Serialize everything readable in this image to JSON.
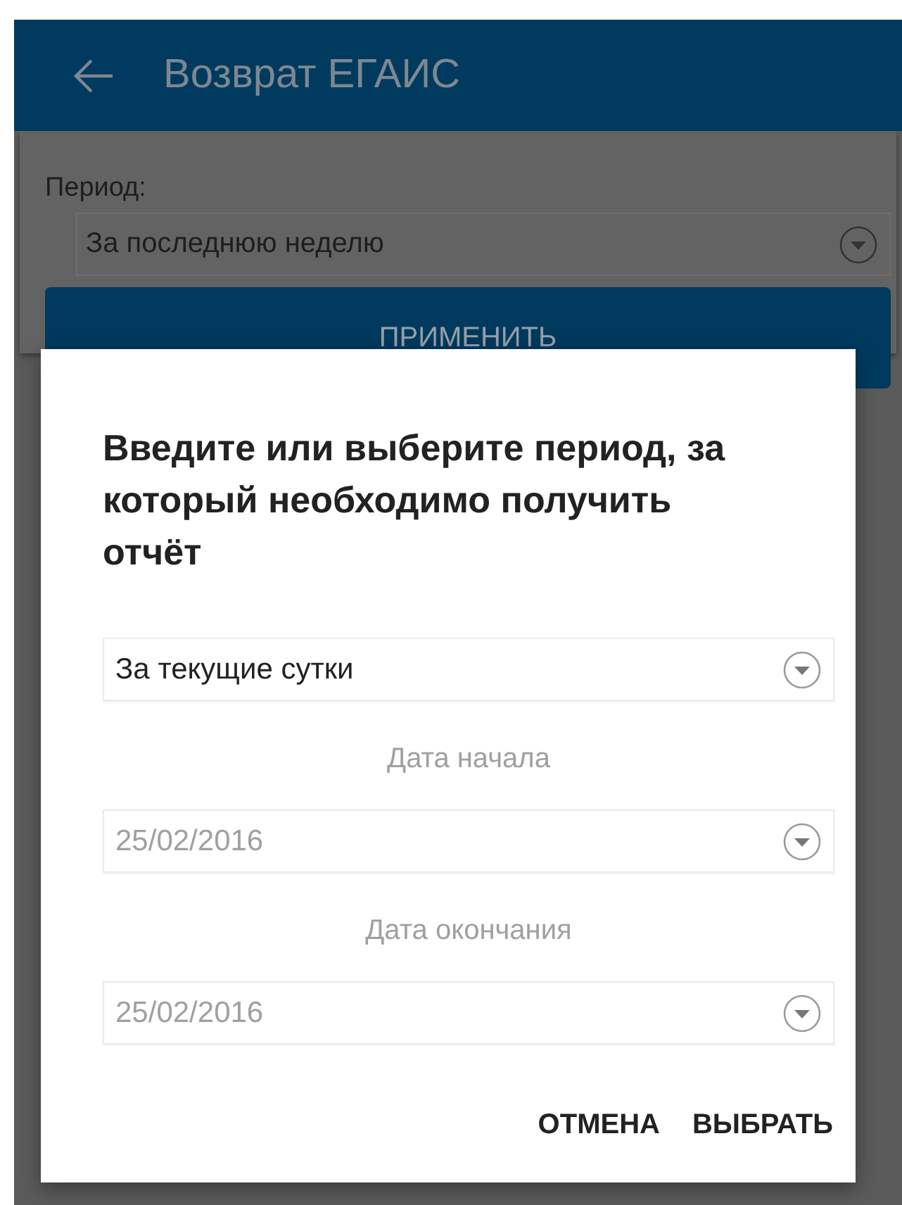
{
  "app_bar": {
    "title": "Возврат ЕГАИС"
  },
  "form": {
    "period_label": "Период:",
    "period_value": "За последнюю неделю",
    "apply_button": "ПРИМЕНИТЬ"
  },
  "dialog": {
    "title": "Введите или выберите период, за который необходимо получить отчёт",
    "period": {
      "value": "За текущие сутки",
      "disabled": false
    },
    "fields": [
      {
        "label": "Дата начала",
        "value": "25/02/2016",
        "disabled": true
      },
      {
        "label": "Дата окончания",
        "value": "25/02/2016",
        "disabled": true
      }
    ],
    "buttons": [
      "ОТМЕНА",
      "ВЫБРАТЬ"
    ]
  }
}
